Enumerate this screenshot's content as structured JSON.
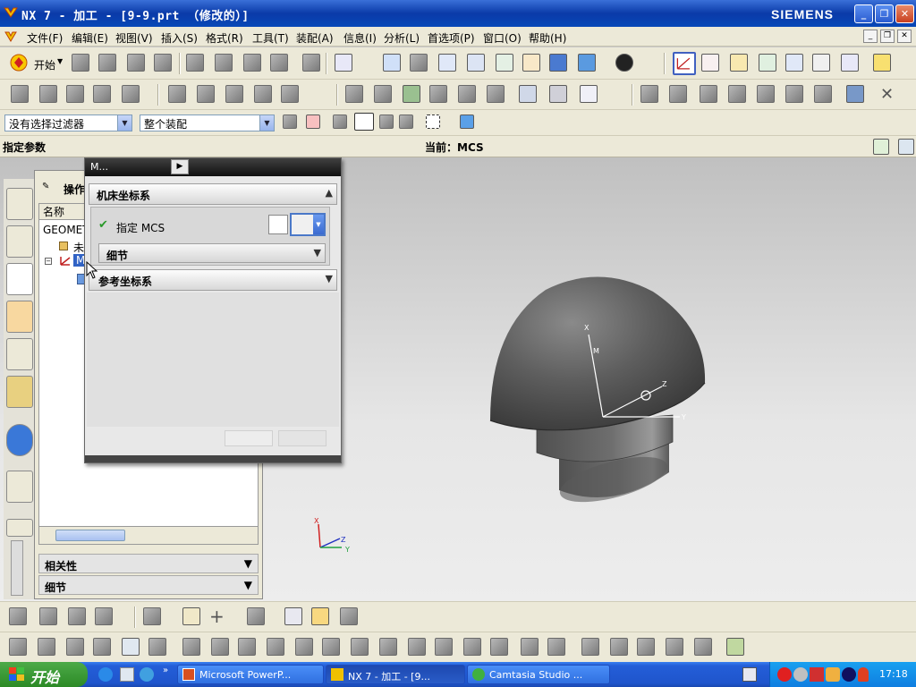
{
  "window": {
    "title": "NX 7 - 加工 - [9-9.prt （修改的）]",
    "brand": "SIEMENS"
  },
  "menu": {
    "items": [
      "文件(F)",
      "编辑(E)",
      "视图(V)",
      "插入(S)",
      "格式(R)",
      "工具(T)",
      "装配(A)",
      "信息(I)",
      "分析(L)",
      "首选项(P)",
      "窗口(O)",
      "帮助(H)"
    ]
  },
  "toolbar": {
    "start_label": "开始"
  },
  "filters": {
    "selection_filter": "没有选择过滤器",
    "assembly_scope": "整个装配"
  },
  "infobar": {
    "prompt": "指定参数",
    "current": "当前：MCS"
  },
  "navigator": {
    "title": "操作",
    "column_name": "名称",
    "rows": [
      "GEOMET",
      "未",
      "M"
    ],
    "sections": [
      "相关性",
      "细节"
    ]
  },
  "dialog": {
    "title": "M...",
    "section_machine": "机床坐标系",
    "specify_mcs": "指定 MCS",
    "details": "细节",
    "section_reference": "参考坐标系"
  },
  "model": {
    "csys_labels": [
      "X",
      "Z",
      "Y",
      "M"
    ]
  },
  "triad": {
    "labels": [
      "X",
      "Z",
      "Y"
    ]
  },
  "taskbar": {
    "start": "开始",
    "tasks": [
      "Microsoft PowerP...",
      "NX 7 - 加工 - [9...",
      "Camtasia Studio ..."
    ],
    "clock": "17:18"
  },
  "colors": {
    "titlebar": "#0a3aa8",
    "taskbar": "#245ed8",
    "start": "#2c8a26",
    "chrome": "#ece9d8"
  }
}
